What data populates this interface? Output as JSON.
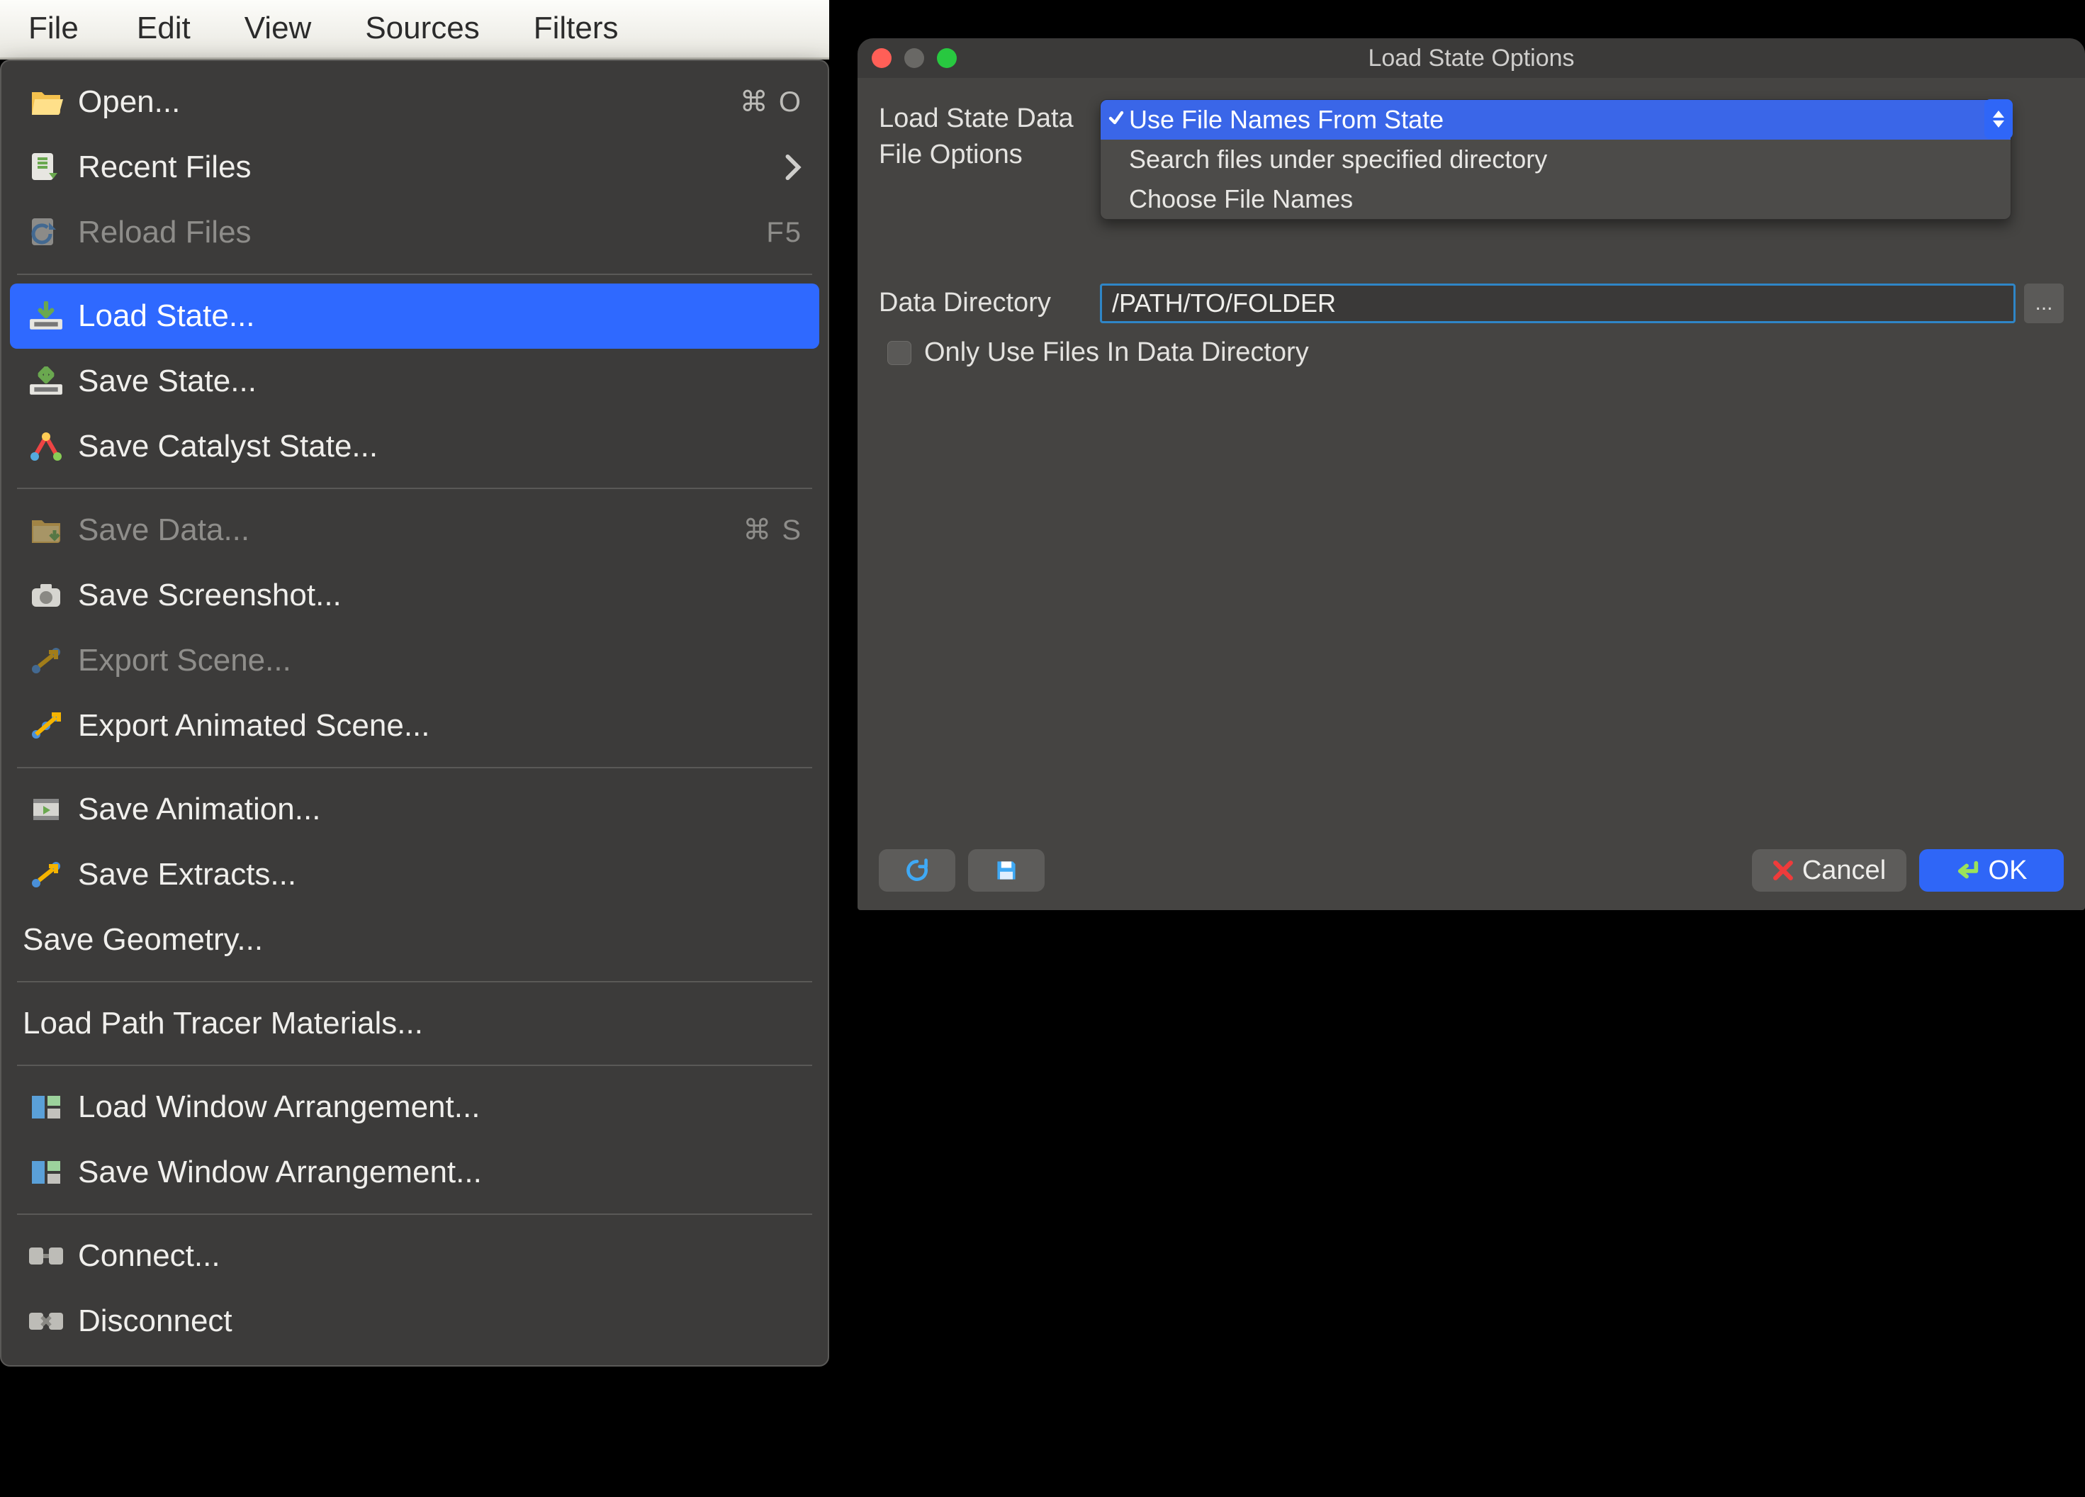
{
  "menubar": [
    "File",
    "Edit",
    "View",
    "Sources",
    "Filters"
  ],
  "dropdown": {
    "groups": [
      [
        {
          "icon": "folder-open",
          "label": "Open...",
          "shortcut": "⌘ O"
        },
        {
          "icon": "recent",
          "label": "Recent Files",
          "chevron": true
        },
        {
          "icon": "reload",
          "label": "Reload Files",
          "shortcut": "F5",
          "disabled": true
        }
      ],
      [
        {
          "icon": "load-state",
          "label": "Load State...",
          "highlight": true
        },
        {
          "icon": "save-state",
          "label": "Save State..."
        },
        {
          "icon": "save-catalyst",
          "label": "Save Catalyst State..."
        }
      ],
      [
        {
          "icon": "save-data",
          "label": "Save Data...",
          "shortcut": "⌘ S",
          "disabled": true
        },
        {
          "icon": "screenshot",
          "label": "Save Screenshot..."
        },
        {
          "icon": "export-scene",
          "label": "Export Scene...",
          "disabled": true
        },
        {
          "icon": "export-anim-scene",
          "label": "Export Animated Scene..."
        }
      ],
      [
        {
          "icon": "save-animation",
          "label": "Save Animation..."
        },
        {
          "icon": "save-extracts",
          "label": "Save Extracts..."
        },
        {
          "noicon": true,
          "label": "Save Geometry..."
        }
      ],
      [
        {
          "noicon": true,
          "label": "Load Path Tracer Materials..."
        }
      ],
      [
        {
          "icon": "window-arr",
          "label": "Load Window Arrangement..."
        },
        {
          "icon": "window-arr",
          "label": "Save Window Arrangement..."
        }
      ],
      [
        {
          "icon": "connect",
          "label": "Connect..."
        },
        {
          "icon": "disconnect",
          "label": "Disconnect"
        }
      ]
    ]
  },
  "dialog": {
    "title": "Load State Options",
    "field1_label_line1": "Load State Data",
    "field1_label_line2": "File Options",
    "combo_options": [
      {
        "label": "Use File Names From State",
        "selected": true
      },
      {
        "label": "Search files under specified directory"
      },
      {
        "label": "Choose File Names"
      }
    ],
    "field2_label": "Data Directory",
    "data_directory_value": "/PATH/TO/FOLDER",
    "browse_label": "...",
    "checkbox_label": "Only Use Files In Data Directory",
    "footer": {
      "cancel": "Cancel",
      "ok": "OK"
    }
  }
}
